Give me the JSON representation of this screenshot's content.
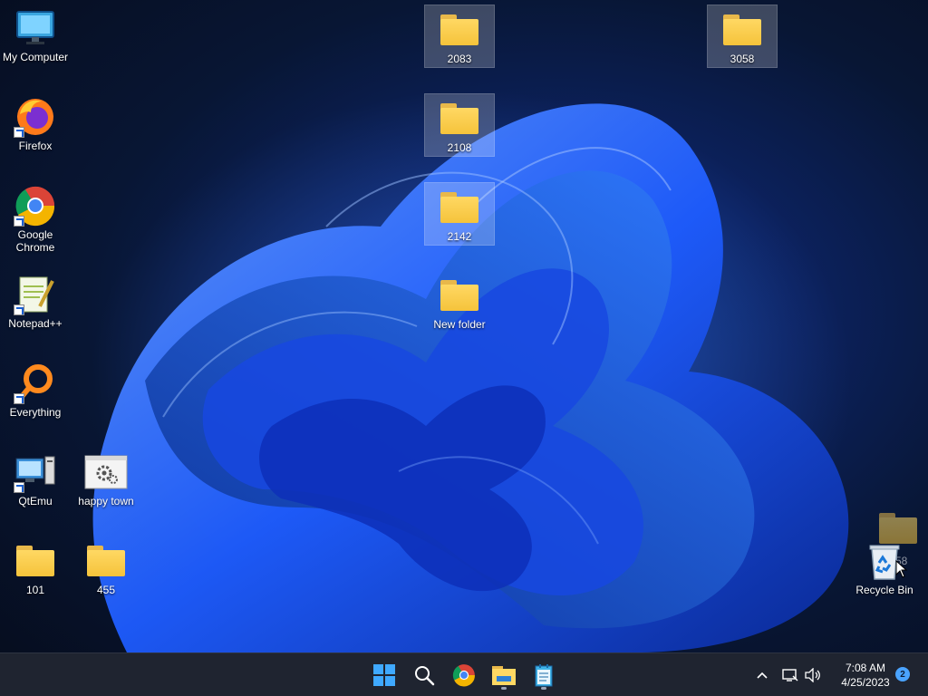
{
  "desktop": {
    "icons": {
      "my_computer": "My Computer",
      "firefox": "Firefox",
      "google_chrome": "Google Chrome",
      "notepadpp": "Notepad++",
      "everything": "Everything",
      "qtemu": "QtEmu",
      "happy_town": "happy town",
      "folder_101": "101",
      "folder_455": "455",
      "folder_2083": "2083",
      "folder_2108": "2108",
      "folder_2142": "2142",
      "new_folder": "New folder",
      "folder_3058": "3058",
      "recycle_bin": "Recycle Bin",
      "dragging_folder_partial": "58"
    }
  },
  "taskbar": {
    "time": "7:08 AM",
    "date": "4/25/2023",
    "notification_count": "2",
    "icons": [
      "start-icon",
      "search-icon",
      "chrome-icon",
      "file-explorer-icon",
      "notepad-icon"
    ]
  },
  "colors": {
    "folder": "#f5c33b",
    "taskbar": "#1f2430",
    "wallpaper_accent": "#1e5cff"
  }
}
